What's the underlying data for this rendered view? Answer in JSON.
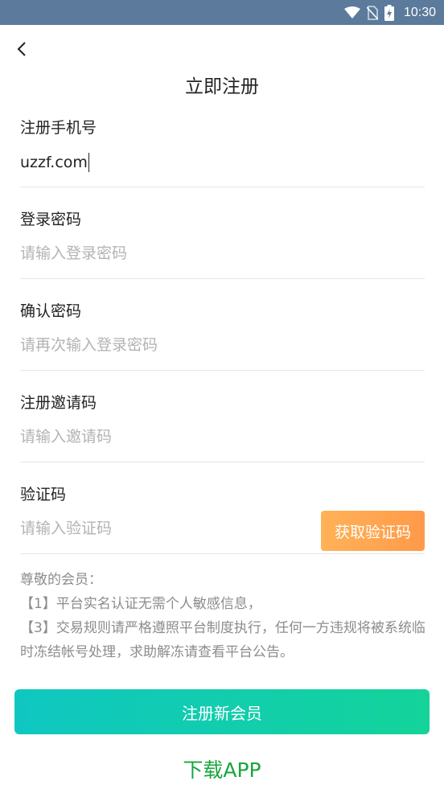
{
  "status_bar": {
    "time": "10:30",
    "icons": [
      "wifi-icon",
      "no-sim-icon",
      "battery-charging-icon"
    ]
  },
  "header": {
    "back_icon": "chevron-left-icon",
    "title": "立即注册"
  },
  "form": {
    "phone": {
      "label": "注册手机号",
      "value": "uzzf.com"
    },
    "password": {
      "label": "登录密码",
      "placeholder": "请输入登录密码"
    },
    "confirm_password": {
      "label": "确认密码",
      "placeholder": "请再次输入登录密码"
    },
    "invite_code": {
      "label": "注册邀请码",
      "placeholder": "请输入邀请码"
    },
    "verify_code": {
      "label": "验证码",
      "placeholder": "请输入验证码",
      "button_label": "获取验证码"
    }
  },
  "notice": {
    "lines": [
      "尊敬的会员：",
      "【1】平台实名认证无需个人敏感信息，",
      "【3】交易规则请严格遵照平台制度执行，任何一方违规将被系统临时冻结帐号处理，求助解冻请查看平台公告。"
    ]
  },
  "actions": {
    "register_label": "注册新会员",
    "download_label": "下载APP"
  },
  "colors": {
    "status_bar": "#5b7a9c",
    "code_button": "#ffa452",
    "register_button": "#12cdb0",
    "download_link": "#1aa53f"
  }
}
